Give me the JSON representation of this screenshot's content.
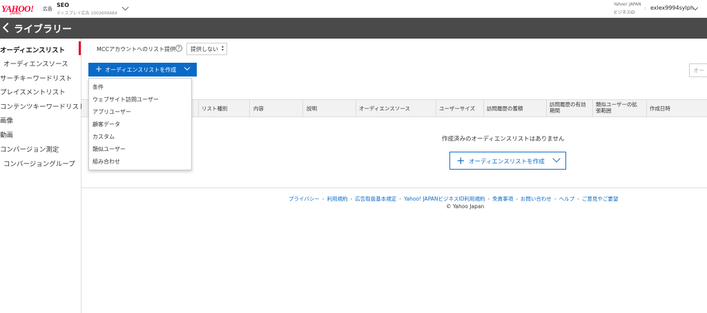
{
  "header": {
    "logo_text": "YAHOO!",
    "logo_sub": "JAPAN",
    "logo_ad": "広告",
    "account_name": "SEO",
    "account_id": "ディスプレイ広告 1002609484",
    "biz_label_1": "Yahoo! JAPAN",
    "biz_label_2": "ビジネスID",
    "biz_colon": ":",
    "user": "exlex9994sylph"
  },
  "page_title": "ライブラリー",
  "sidebar": {
    "items": [
      {
        "label": "オーディエンスリスト"
      },
      {
        "label": "オーディエンスソース"
      },
      {
        "label": "サーチキーワードリスト"
      },
      {
        "label": "プレイスメントリスト"
      },
      {
        "label": "コンテンツキーワードリスト"
      },
      {
        "label": "画像"
      },
      {
        "label": "動画"
      },
      {
        "label": "コンバージョン測定"
      },
      {
        "label": "コンバージョングループ"
      }
    ]
  },
  "mcc": {
    "label": "MCCアカウントへのリスト提供",
    "help": "?",
    "value": "提供しない"
  },
  "create_button": {
    "plus": "+",
    "label": "オーディエンスリストを作成"
  },
  "search": {
    "placeholder": "オー"
  },
  "dropdown": {
    "items": [
      "条件",
      "ウェブサイト訪問ユーザー",
      "アプリユーザー",
      "顧客データ",
      "カスタム",
      "類似ユーザー",
      "組み合わせ"
    ]
  },
  "table": {
    "columns": [
      "リスト種別",
      "内容",
      "説明",
      "オーディエンスソース",
      "ユーザーサイズ",
      "訪問履歴の蓄積",
      "訪問履歴の有効期間",
      "類似ユーザーの拡張範囲",
      "作成日時"
    ]
  },
  "empty_message": "作成済みのオーディエンスリストはありません",
  "empty_create": {
    "plus": "+",
    "label": "オーディエンスリストを作成"
  },
  "footer": {
    "links": [
      "プライバシー",
      "利用規約",
      "広告取扱基本規定",
      "Yahoo! JAPANビジネスID利用規約",
      "免責事項",
      "お問い合わせ",
      "ヘルプ",
      "ご意見やご要望"
    ],
    "separator": "-",
    "copyright": "© Yahoo Japan"
  },
  "colors": {
    "accent": "#0a6ac8",
    "title_bar": "#4a4a4a",
    "active_marker": "#e60012",
    "logo": "#ff0033"
  }
}
